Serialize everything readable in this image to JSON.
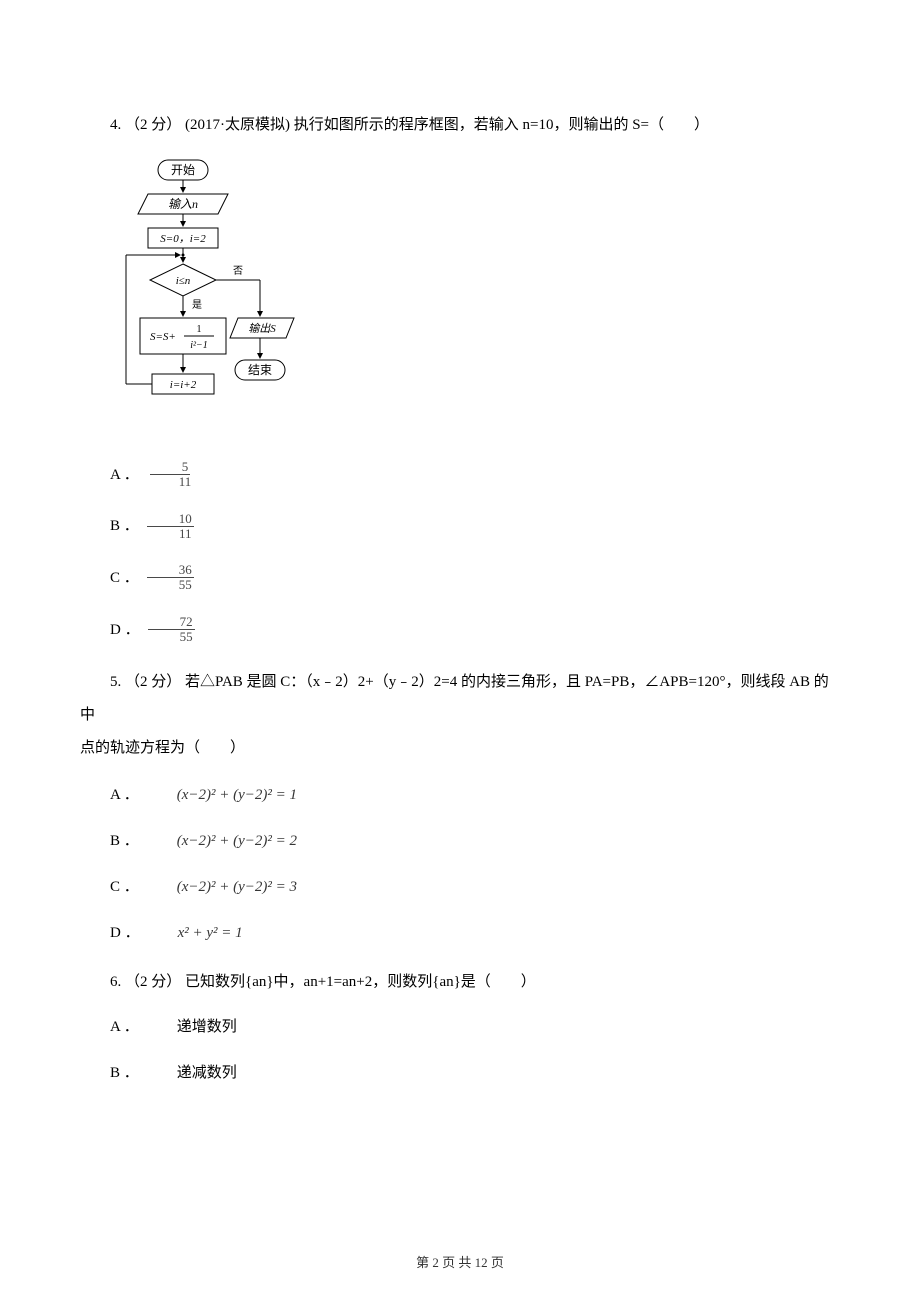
{
  "q4": {
    "stem": "4. （2 分） (2017·太原模拟) 执行如图所示的程序框图，若输入 n=10，则输出的 S=（　　）",
    "flowchart": {
      "start": "开始",
      "input": "输入n",
      "init": "S=0，i=2",
      "cond": "i≤n",
      "cond_no": "否",
      "cond_yes": "是",
      "calc_prefix": "S=S+",
      "calc_num": "1",
      "calc_den": "i²−1",
      "inc": "i=i+2",
      "output": "输出S",
      "end": "结束"
    },
    "optA": {
      "label": "A ．",
      "num": "5",
      "den": "11"
    },
    "optB": {
      "label": "B ．",
      "num": "10",
      "den": "11"
    },
    "optC": {
      "label": "C ．",
      "num": "36",
      "den": "55"
    },
    "optD": {
      "label": "D ．",
      "num": "72",
      "den": "55"
    }
  },
  "q5": {
    "stem_part1": "5. （2 分） 若△PAB 是圆 C：（x﹣2）2+（y﹣2）2=4 的内接三角形，且 PA=PB，∠APB=120°，则线段 AB 的中",
    "stem_part2": "点的轨迹方程为（　　）",
    "optA": {
      "label": "A ．",
      "eq": "(x−2)² + (y−2)² = 1"
    },
    "optB": {
      "label": "B ．",
      "eq": "(x−2)² + (y−2)² = 2"
    },
    "optC": {
      "label": "C ．",
      "eq": "(x−2)² + (y−2)² = 3"
    },
    "optD": {
      "label": "D ．",
      "eq": "x² + y² = 1"
    }
  },
  "q6": {
    "stem": "6. （2 分） 已知数列{an}中，an+1=an+2，则数列{an}是（　　）",
    "optA": {
      "label": "A ．",
      "text": "递增数列"
    },
    "optB": {
      "label": "B ．",
      "text": "递减数列"
    }
  },
  "footer": "第 2 页 共 12 页"
}
